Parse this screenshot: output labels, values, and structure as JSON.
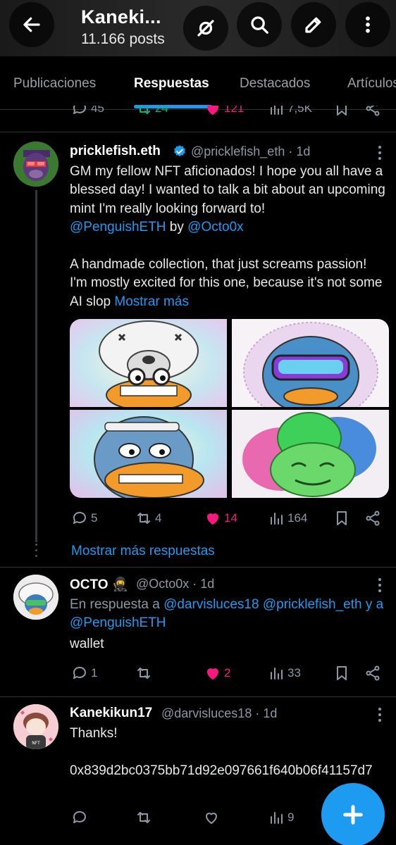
{
  "header": {
    "title": "Kaneki...",
    "subtitle": "11.166 posts",
    "icons": [
      "back-arrow-icon",
      "mute-icon",
      "search-icon",
      "edit-icon",
      "more-vertical-icon"
    ]
  },
  "tabs": [
    {
      "label": "Publicaciones"
    },
    {
      "label": "Respuestas"
    },
    {
      "label": "Destacados"
    },
    {
      "label": "Artículos"
    }
  ],
  "prev_actions": {
    "replies": "45",
    "reposts": "24",
    "likes": "121",
    "views": "7,5K"
  },
  "tweets": [
    {
      "name": "pricklefish.eth",
      "handle": "@pricklefish_eth · 1d",
      "verified": true,
      "text_1": "GM my fellow NFT aficionados! I hope you all have a blessed day! I wanted to talk a bit about an upcoming mint I'm really looking forward to!",
      "mention_1": "@PenguishETH",
      "by": " by ",
      "mention_2": "@Octo0x",
      "text_2": "A handmade collection, that just screams passion! I'm mostly excited for this one, because it's not some AI slop ",
      "show_more": "Mostrar más",
      "actions": {
        "replies": "5",
        "reposts": "4",
        "likes": "14",
        "views": "164"
      }
    },
    {
      "name": "OCTO",
      "name_emoji": "🥷",
      "handle": "@Octo0x · 1d",
      "reply_prefix": "En respuesta a ",
      "reply_to_1": "@darvisluces18",
      "reply_to_2": "@pricklefish_eth",
      "reply_and": " y a ",
      "reply_to_3": "@PenguishETH",
      "text": "wallet",
      "actions": {
        "replies": "1",
        "reposts": "",
        "likes": "2",
        "views": "33"
      }
    },
    {
      "name": "Kanekikun17",
      "handle": "@darvisluces18 · 1d",
      "text_1": "Thanks!",
      "text_2": "0x839d2bc0375bb71d92e097661f640b06f41157d7",
      "actions": {
        "replies": "",
        "reposts": "",
        "likes": "",
        "views": "9"
      }
    }
  ],
  "show_more_replies": "Mostrar más respuestas",
  "colors": {
    "accent": "#1d9bf0",
    "like": "#f91880",
    "repost": "#00ba7c",
    "muted": "#8b98a5"
  }
}
